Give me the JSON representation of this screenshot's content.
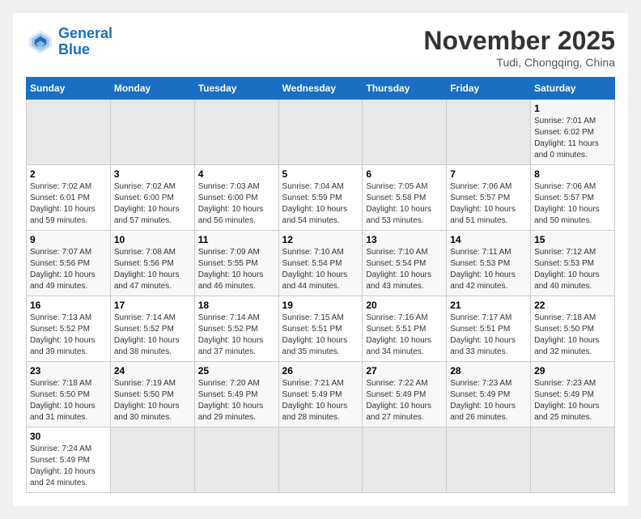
{
  "logo": {
    "line1": "General",
    "line2": "Blue"
  },
  "title": "November 2025",
  "location": "Tudi, Chongqing, China",
  "days_header": [
    "Sunday",
    "Monday",
    "Tuesday",
    "Wednesday",
    "Thursday",
    "Friday",
    "Saturday"
  ],
  "weeks": [
    [
      {
        "day": "",
        "info": ""
      },
      {
        "day": "",
        "info": ""
      },
      {
        "day": "",
        "info": ""
      },
      {
        "day": "",
        "info": ""
      },
      {
        "day": "",
        "info": ""
      },
      {
        "day": "",
        "info": ""
      },
      {
        "day": "1",
        "info": "Sunrise: 7:01 AM\nSunset: 6:02 PM\nDaylight: 11 hours and 0 minutes."
      }
    ],
    [
      {
        "day": "2",
        "info": "Sunrise: 7:02 AM\nSunset: 6:01 PM\nDaylight: 10 hours and 59 minutes."
      },
      {
        "day": "3",
        "info": "Sunrise: 7:02 AM\nSunset: 6:00 PM\nDaylight: 10 hours and 57 minutes."
      },
      {
        "day": "4",
        "info": "Sunrise: 7:03 AM\nSunset: 6:00 PM\nDaylight: 10 hours and 56 minutes."
      },
      {
        "day": "5",
        "info": "Sunrise: 7:04 AM\nSunset: 5:59 PM\nDaylight: 10 hours and 54 minutes."
      },
      {
        "day": "6",
        "info": "Sunrise: 7:05 AM\nSunset: 5:58 PM\nDaylight: 10 hours and 53 minutes."
      },
      {
        "day": "7",
        "info": "Sunrise: 7:06 AM\nSunset: 5:57 PM\nDaylight: 10 hours and 51 minutes."
      },
      {
        "day": "8",
        "info": "Sunrise: 7:06 AM\nSunset: 5:57 PM\nDaylight: 10 hours and 50 minutes."
      }
    ],
    [
      {
        "day": "9",
        "info": "Sunrise: 7:07 AM\nSunset: 5:56 PM\nDaylight: 10 hours and 49 minutes."
      },
      {
        "day": "10",
        "info": "Sunrise: 7:08 AM\nSunset: 5:56 PM\nDaylight: 10 hours and 47 minutes."
      },
      {
        "day": "11",
        "info": "Sunrise: 7:09 AM\nSunset: 5:55 PM\nDaylight: 10 hours and 46 minutes."
      },
      {
        "day": "12",
        "info": "Sunrise: 7:10 AM\nSunset: 5:54 PM\nDaylight: 10 hours and 44 minutes."
      },
      {
        "day": "13",
        "info": "Sunrise: 7:10 AM\nSunset: 5:54 PM\nDaylight: 10 hours and 43 minutes."
      },
      {
        "day": "14",
        "info": "Sunrise: 7:11 AM\nSunset: 5:53 PM\nDaylight: 10 hours and 42 minutes."
      },
      {
        "day": "15",
        "info": "Sunrise: 7:12 AM\nSunset: 5:53 PM\nDaylight: 10 hours and 40 minutes."
      }
    ],
    [
      {
        "day": "16",
        "info": "Sunrise: 7:13 AM\nSunset: 5:52 PM\nDaylight: 10 hours and 39 minutes."
      },
      {
        "day": "17",
        "info": "Sunrise: 7:14 AM\nSunset: 5:52 PM\nDaylight: 10 hours and 38 minutes."
      },
      {
        "day": "18",
        "info": "Sunrise: 7:14 AM\nSunset: 5:52 PM\nDaylight: 10 hours and 37 minutes."
      },
      {
        "day": "19",
        "info": "Sunrise: 7:15 AM\nSunset: 5:51 PM\nDaylight: 10 hours and 35 minutes."
      },
      {
        "day": "20",
        "info": "Sunrise: 7:16 AM\nSunset: 5:51 PM\nDaylight: 10 hours and 34 minutes."
      },
      {
        "day": "21",
        "info": "Sunrise: 7:17 AM\nSunset: 5:51 PM\nDaylight: 10 hours and 33 minutes."
      },
      {
        "day": "22",
        "info": "Sunrise: 7:18 AM\nSunset: 5:50 PM\nDaylight: 10 hours and 32 minutes."
      }
    ],
    [
      {
        "day": "23",
        "info": "Sunrise: 7:18 AM\nSunset: 5:50 PM\nDaylight: 10 hours and 31 minutes."
      },
      {
        "day": "24",
        "info": "Sunrise: 7:19 AM\nSunset: 5:50 PM\nDaylight: 10 hours and 30 minutes."
      },
      {
        "day": "25",
        "info": "Sunrise: 7:20 AM\nSunset: 5:49 PM\nDaylight: 10 hours and 29 minutes."
      },
      {
        "day": "26",
        "info": "Sunrise: 7:21 AM\nSunset: 5:49 PM\nDaylight: 10 hours and 28 minutes."
      },
      {
        "day": "27",
        "info": "Sunrise: 7:22 AM\nSunset: 5:49 PM\nDaylight: 10 hours and 27 minutes."
      },
      {
        "day": "28",
        "info": "Sunrise: 7:23 AM\nSunset: 5:49 PM\nDaylight: 10 hours and 26 minutes."
      },
      {
        "day": "29",
        "info": "Sunrise: 7:23 AM\nSunset: 5:49 PM\nDaylight: 10 hours and 25 minutes."
      }
    ],
    [
      {
        "day": "30",
        "info": "Sunrise: 7:24 AM\nSunset: 5:49 PM\nDaylight: 10 hours and 24 minutes."
      },
      {
        "day": "",
        "info": ""
      },
      {
        "day": "",
        "info": ""
      },
      {
        "day": "",
        "info": ""
      },
      {
        "day": "",
        "info": ""
      },
      {
        "day": "",
        "info": ""
      },
      {
        "day": "",
        "info": ""
      }
    ]
  ]
}
